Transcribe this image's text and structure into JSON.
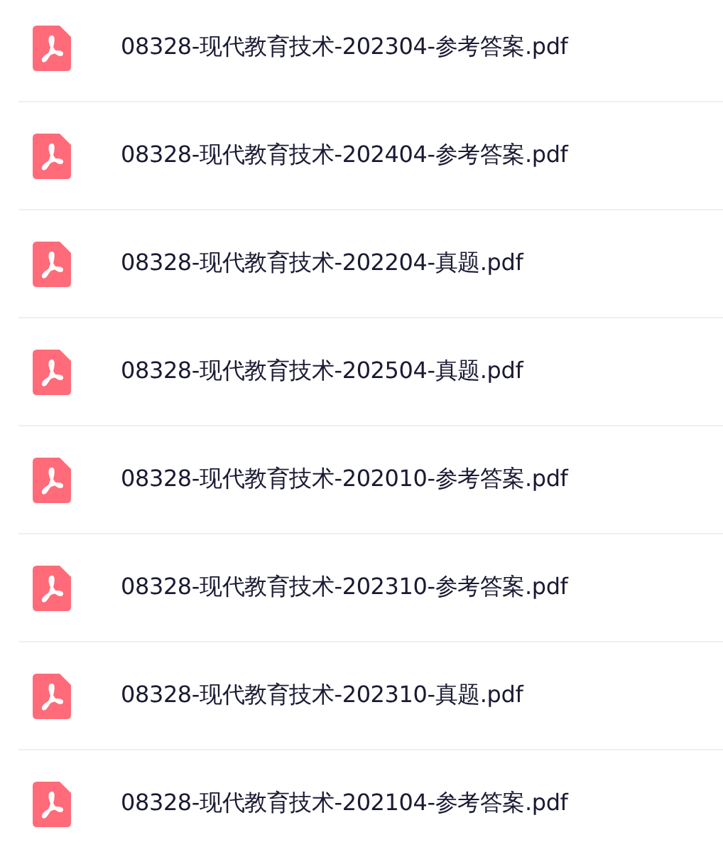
{
  "files": [
    {
      "name": "08328-现代教育技术-202304-参考答案.pdf"
    },
    {
      "name": "08328-现代教育技术-202404-参考答案.pdf"
    },
    {
      "name": "08328-现代教育技术-202204-真题.pdf"
    },
    {
      "name": "08328-现代教育技术-202504-真题.pdf"
    },
    {
      "name": "08328-现代教育技术-202010-参考答案.pdf"
    },
    {
      "name": "08328-现代教育技术-202310-参考答案.pdf"
    },
    {
      "name": "08328-现代教育技术-202310-真题.pdf"
    },
    {
      "name": "08328-现代教育技术-202104-参考答案.pdf"
    }
  ]
}
